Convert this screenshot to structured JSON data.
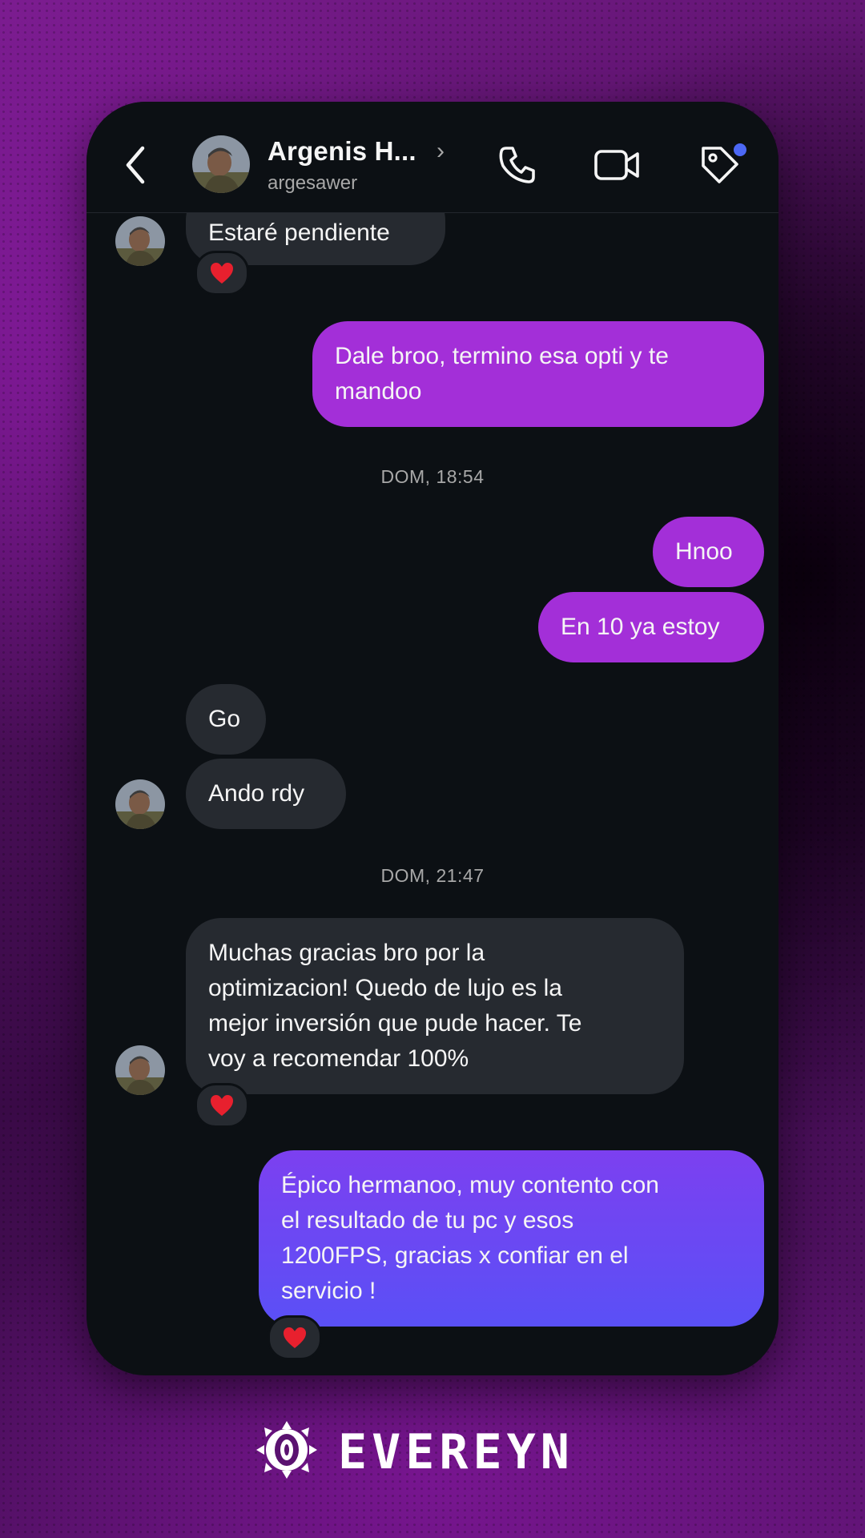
{
  "header": {
    "name": "Argenis H...",
    "username": "argesawer"
  },
  "messages": [
    {
      "id": "m1",
      "direction": "incoming",
      "text": "Estaré pendiente",
      "reaction": "heart"
    },
    {
      "id": "m2",
      "direction": "outgoing",
      "text": "Dale broo, termino esa opti y te mandoo"
    },
    {
      "id": "t1",
      "type": "timestamp",
      "text": "DOM, 18:54"
    },
    {
      "id": "m3",
      "direction": "outgoing",
      "text": "Hnoo"
    },
    {
      "id": "m4",
      "direction": "outgoing",
      "text": "En 10 ya estoy"
    },
    {
      "id": "m5",
      "direction": "incoming",
      "text": "Go"
    },
    {
      "id": "m6",
      "direction": "incoming",
      "text": "Ando rdy"
    },
    {
      "id": "t2",
      "type": "timestamp",
      "text": "DOM, 21:47"
    },
    {
      "id": "m7",
      "direction": "incoming",
      "lines": [
        "Muchas gracias bro por la",
        "optimizacion! Quedo de lujo es la",
        "mejor inversión que pude hacer. Te",
        "voy a recomendar 100%"
      ],
      "reaction": "heart"
    },
    {
      "id": "m8",
      "direction": "outgoing",
      "lines": [
        "Épico hermanoo, muy contento con",
        "el resultado de tu pc y esos",
        "1200FPS, gracias x confiar en el",
        "servicio !"
      ],
      "reaction": "heart"
    }
  ],
  "colors": {
    "outgoing_bubble": "#a32fd8",
    "outgoing_bubble_last": "#6a48f4",
    "incoming_bubble": "#262a30",
    "chat_background": "#0c1014",
    "notification_dot": "#4c68f5",
    "reaction_heart": "#e8202e"
  },
  "icons": [
    "back-arrow-icon",
    "phone-icon",
    "video-camera-icon",
    "tag-icon",
    "heart-icon",
    "brand-logo-icon"
  ],
  "brand": {
    "logo_text": "EVEREYN"
  }
}
